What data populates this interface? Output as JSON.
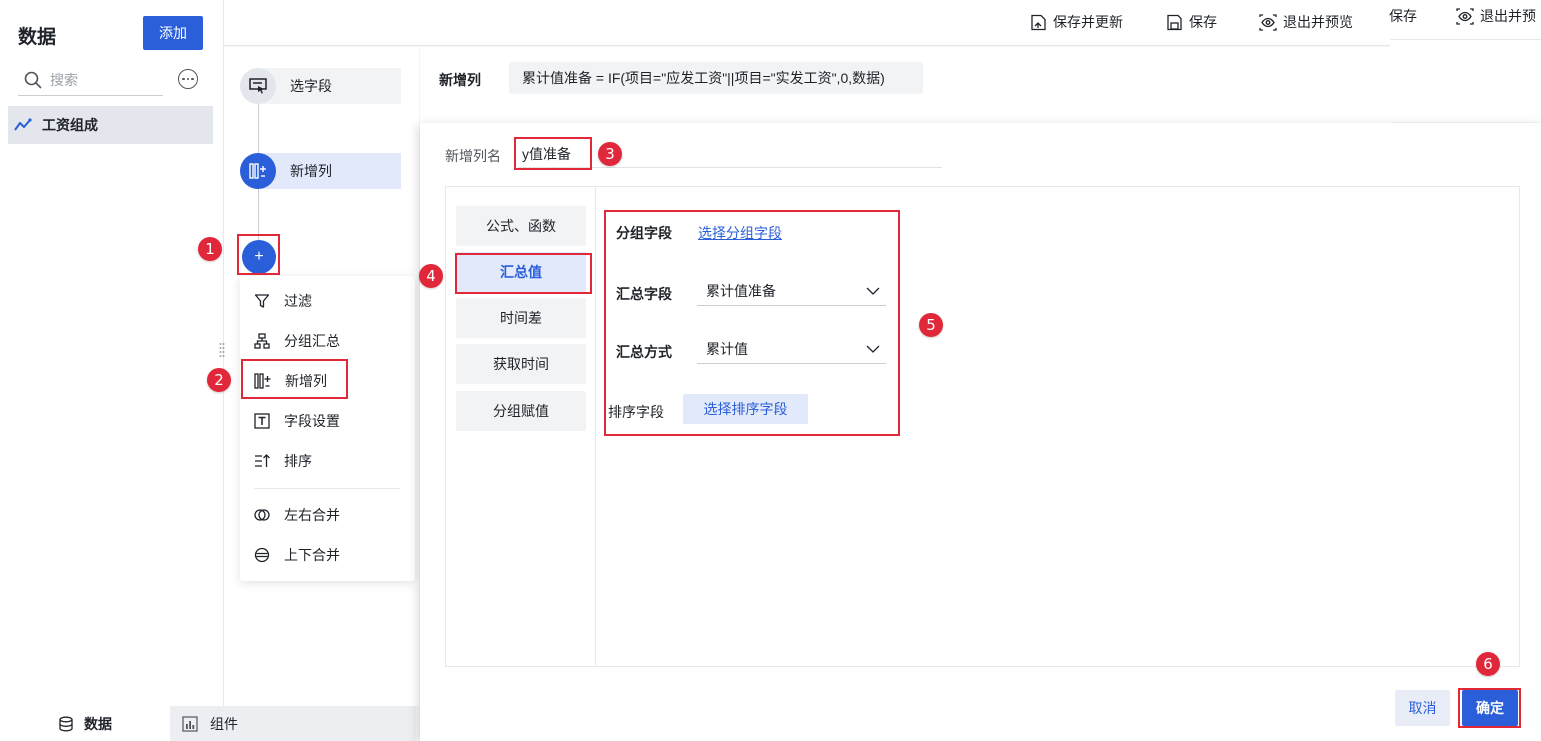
{
  "left_panel": {
    "title": "数据",
    "add_label": "添加",
    "search_placeholder": "搜索",
    "dataset_name": "工资组成"
  },
  "bottom_tabs": {
    "data": "数据",
    "component": "组件"
  },
  "toolbar": {
    "save_update": "保存并更新",
    "save": "保存",
    "exit_preview": "退出并预览",
    "save_partial": "保存",
    "exit_preview_partial": "退出并预"
  },
  "steps": {
    "select_fields": "选字段",
    "new_column": "新增列",
    "add": "+"
  },
  "menu": {
    "filter": "过滤",
    "group_summary": "分组汇总",
    "new_column": "新增列",
    "field_settings": "字段设置",
    "sort": "排序",
    "merge_lr": "左右合并",
    "merge_ud": "上下合并"
  },
  "formula": {
    "label": "新增列",
    "text": "累计值准备 = IF(项目=\"应发工资\"||项目=\"实发工资\",0,数据)"
  },
  "dialog": {
    "name_label": "新增列名",
    "name_value": "y值准备",
    "tabs": [
      "公式、函数",
      "汇总值",
      "时间差",
      "获取时间",
      "分组赋值"
    ],
    "active_tab": "汇总值",
    "group_field_label": "分组字段",
    "group_field_link": "选择分组字段",
    "sum_field_label": "汇总字段",
    "sum_field_value": "累计值准备",
    "sum_mode_label": "汇总方式",
    "sum_mode_value": "累计值",
    "sort_field_label": "排序字段",
    "sort_field_button": "选择排序字段",
    "cancel": "取消",
    "confirm": "确定"
  },
  "annotations": [
    "1",
    "2",
    "3",
    "4",
    "5",
    "6"
  ],
  "colors": {
    "primary": "#2b5fd9",
    "highlight": "#e0283a",
    "active_bg": "#e1e9fb"
  }
}
